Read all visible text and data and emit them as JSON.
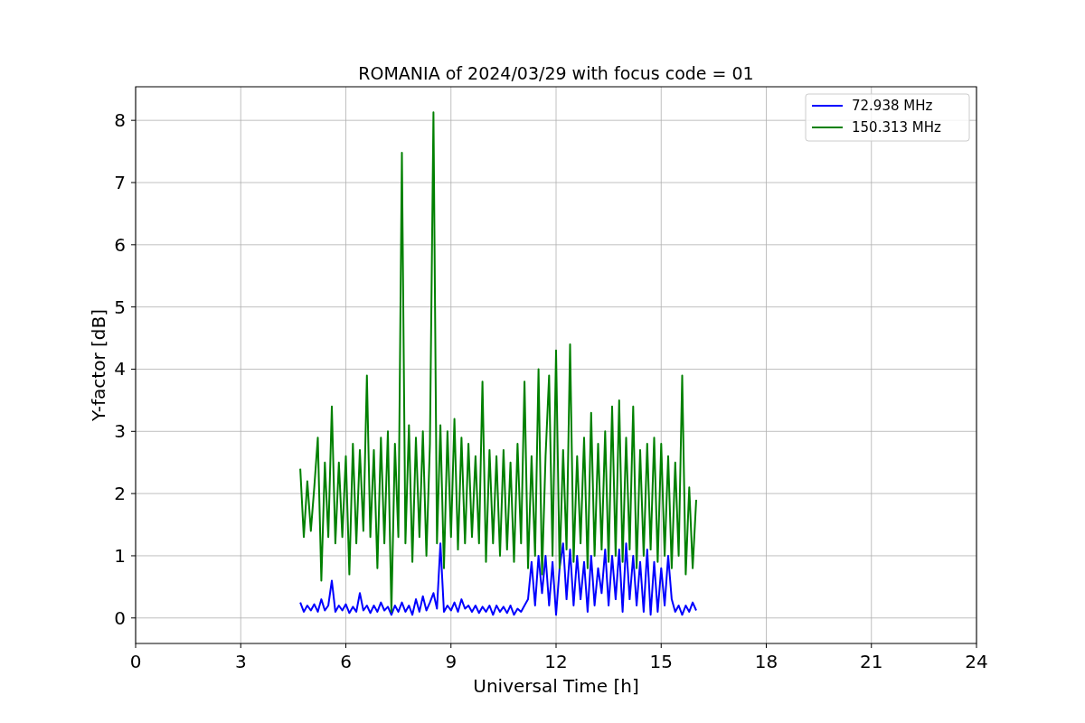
{
  "chart_data": {
    "type": "line",
    "title": "ROMANIA of 2024/03/29 with focus code = 01",
    "xlabel": "Universal Time [h]",
    "ylabel": "Y-factor [dB]",
    "xlim": [
      0,
      24
    ],
    "ylim": [
      -0.41,
      8.54
    ],
    "xticks": [
      0,
      3,
      6,
      9,
      12,
      15,
      18,
      21,
      24
    ],
    "yticks": [
      0,
      1,
      2,
      3,
      4,
      5,
      6,
      7,
      8
    ],
    "grid": true,
    "legend": "upper right",
    "x": [
      4.7,
      4.8,
      4.9,
      5.0,
      5.1,
      5.2,
      5.3,
      5.4,
      5.5,
      5.6,
      5.7,
      5.8,
      5.9,
      6.0,
      6.1,
      6.2,
      6.3,
      6.4,
      6.5,
      6.6,
      6.7,
      6.8,
      6.9,
      7.0,
      7.1,
      7.2,
      7.3,
      7.4,
      7.5,
      7.6,
      7.7,
      7.8,
      7.9,
      8.0,
      8.1,
      8.2,
      8.3,
      8.4,
      8.5,
      8.6,
      8.7,
      8.8,
      8.9,
      9.0,
      9.1,
      9.2,
      9.3,
      9.4,
      9.5,
      9.6,
      9.7,
      9.8,
      9.9,
      10.0,
      10.1,
      10.2,
      10.3,
      10.4,
      10.5,
      10.6,
      10.7,
      10.8,
      10.9,
      11.0,
      11.1,
      11.2,
      11.3,
      11.4,
      11.5,
      11.6,
      11.7,
      11.8,
      11.9,
      12.0,
      12.1,
      12.2,
      12.3,
      12.4,
      12.5,
      12.6,
      12.7,
      12.8,
      12.9,
      13.0,
      13.1,
      13.2,
      13.3,
      13.4,
      13.5,
      13.6,
      13.7,
      13.8,
      13.9,
      14.0,
      14.1,
      14.2,
      14.3,
      14.4,
      14.5,
      14.6,
      14.7,
      14.8,
      14.9,
      15.0,
      15.1,
      15.2,
      15.3,
      15.4,
      15.5,
      15.6,
      15.7,
      15.8,
      15.9,
      16.0
    ],
    "series": [
      {
        "name": "72.938 MHz",
        "color": "#0000ff",
        "values": [
          0.25,
          0.1,
          0.2,
          0.12,
          0.22,
          0.1,
          0.3,
          0.12,
          0.2,
          0.6,
          0.1,
          0.2,
          0.12,
          0.22,
          0.08,
          0.18,
          0.1,
          0.4,
          0.12,
          0.2,
          0.08,
          0.2,
          0.1,
          0.25,
          0.12,
          0.18,
          0.05,
          0.2,
          0.1,
          0.25,
          0.1,
          0.2,
          0.05,
          0.3,
          0.1,
          0.35,
          0.12,
          0.25,
          0.4,
          0.15,
          1.2,
          0.1,
          0.2,
          0.12,
          0.25,
          0.1,
          0.3,
          0.15,
          0.2,
          0.1,
          0.2,
          0.08,
          0.18,
          0.1,
          0.2,
          0.05,
          0.2,
          0.1,
          0.18,
          0.08,
          0.2,
          0.05,
          0.15,
          0.1,
          0.2,
          0.3,
          0.9,
          0.2,
          1.0,
          0.4,
          1.0,
          0.2,
          0.9,
          0.05,
          0.8,
          1.2,
          0.3,
          1.1,
          0.2,
          1.0,
          0.3,
          0.9,
          0.1,
          1.0,
          0.2,
          0.8,
          0.4,
          1.1,
          0.2,
          1.0,
          0.3,
          1.1,
          0.1,
          1.2,
          0.3,
          1.0,
          0.2,
          0.9,
          0.1,
          1.1,
          0.05,
          0.9,
          0.1,
          0.8,
          0.2,
          1.0,
          0.3,
          0.1,
          0.2,
          0.05,
          0.2,
          0.1,
          0.25,
          0.12
        ]
      },
      {
        "name": "150.313 MHz",
        "color": "#008000",
        "values": [
          2.4,
          1.3,
          2.2,
          1.4,
          2.1,
          2.9,
          0.6,
          2.5,
          1.3,
          3.4,
          1.2,
          2.5,
          1.3,
          2.6,
          0.7,
          2.8,
          1.2,
          2.7,
          1.4,
          3.9,
          1.3,
          2.7,
          0.8,
          2.9,
          1.2,
          3.0,
          0.1,
          2.8,
          1.3,
          7.48,
          1.2,
          3.1,
          0.9,
          2.9,
          1.3,
          3.0,
          1.0,
          2.8,
          8.13,
          1.2,
          3.1,
          0.8,
          3.0,
          1.3,
          3.2,
          1.1,
          2.9,
          1.2,
          2.8,
          1.3,
          2.6,
          1.2,
          3.8,
          0.9,
          2.7,
          1.2,
          2.6,
          1.0,
          2.7,
          1.1,
          2.5,
          0.9,
          2.8,
          1.2,
          3.8,
          0.8,
          2.6,
          1.0,
          4.0,
          0.7,
          2.6,
          3.9,
          1.0,
          4.3,
          0.8,
          2.7,
          1.1,
          4.4,
          0.9,
          2.6,
          1.2,
          2.9,
          0.8,
          3.3,
          1.0,
          2.8,
          1.1,
          3.0,
          0.9,
          3.4,
          1.0,
          3.5,
          0.9,
          2.9,
          1.1,
          3.4,
          0.8,
          2.7,
          1.0,
          2.8,
          1.1,
          2.9,
          0.9,
          2.8,
          1.0,
          2.6,
          0.8,
          2.5,
          1.0,
          3.9,
          0.7,
          2.1,
          0.8,
          1.9
        ]
      }
    ]
  }
}
